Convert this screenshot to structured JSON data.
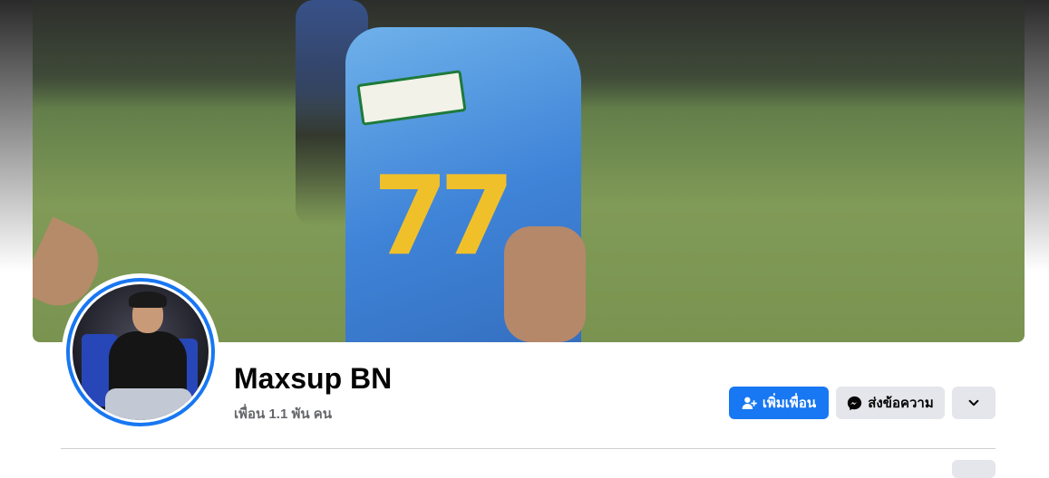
{
  "profile": {
    "name": "Maxsup BN",
    "friends_count": "เพื่อน 1.1 พัน คน"
  },
  "actions": {
    "add_friend_label": "เพิ่มเพื่อน",
    "message_label": "ส่งข้อความ",
    "more_icon": "chevron-down-icon"
  },
  "icons": {
    "add_friend": "add-person-icon",
    "messenger": "messenger-icon"
  },
  "colors": {
    "accent": "#1877f2",
    "secondary_button": "#e4e6eb",
    "text_primary": "#050505",
    "text_secondary": "#65676b"
  }
}
